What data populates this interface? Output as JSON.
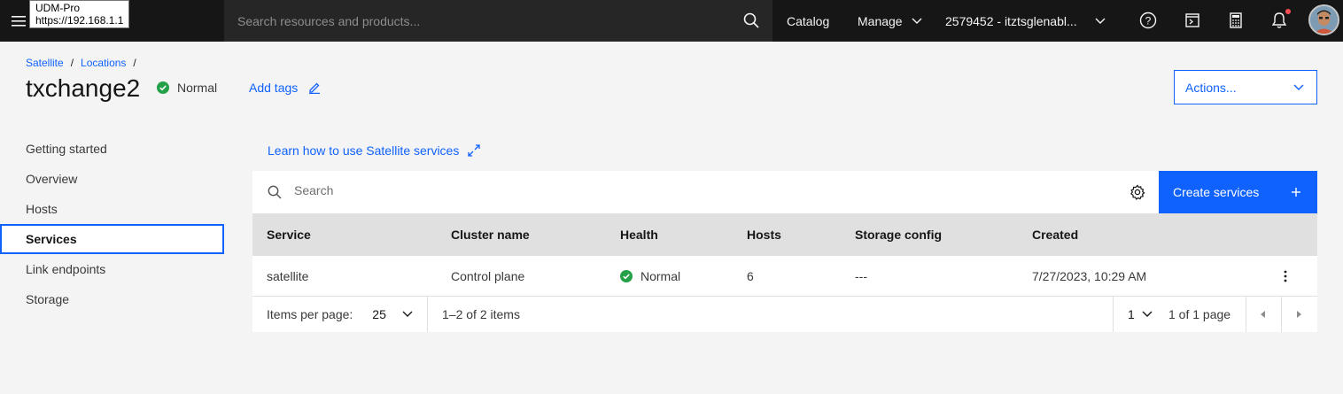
{
  "header": {
    "tooltip_line1": "UDM-Pro",
    "tooltip_line2": "https://192.168.1.1",
    "search_placeholder": "Search resources and products...",
    "catalog": "Catalog",
    "manage": "Manage",
    "account": "2579452 - itztsglenabl..."
  },
  "breadcrumb": {
    "satellite": "Satellite",
    "locations": "Locations",
    "sep": "/"
  },
  "page": {
    "title": "txchange2",
    "status": "Normal",
    "add_tags": "Add tags",
    "actions": "Actions..."
  },
  "sidenav": {
    "items": [
      {
        "label": "Getting started"
      },
      {
        "label": "Overview"
      },
      {
        "label": "Hosts"
      },
      {
        "label": "Services"
      },
      {
        "label": "Link endpoints"
      },
      {
        "label": "Storage"
      }
    ]
  },
  "main": {
    "learn_link": "Learn how to use Satellite services",
    "search_placeholder": "Search",
    "create_button": "Create services",
    "columns": [
      "Service",
      "Cluster name",
      "Health",
      "Hosts",
      "Storage config",
      "Created"
    ],
    "rows": [
      {
        "service": "satellite",
        "cluster": "Control plane",
        "health": "Normal",
        "hosts": "6",
        "storage": "---",
        "created": "7/27/2023, 10:29 AM"
      }
    ],
    "pagination": {
      "items_per_page_label": "Items per page:",
      "items_per_page_value": "25",
      "range": "1–2 of 2 items",
      "page": "1",
      "page_of": "1 of 1 page"
    }
  },
  "colors": {
    "accent": "#0f62fe",
    "status_ok": "#24a148",
    "header_bg": "#161616"
  }
}
